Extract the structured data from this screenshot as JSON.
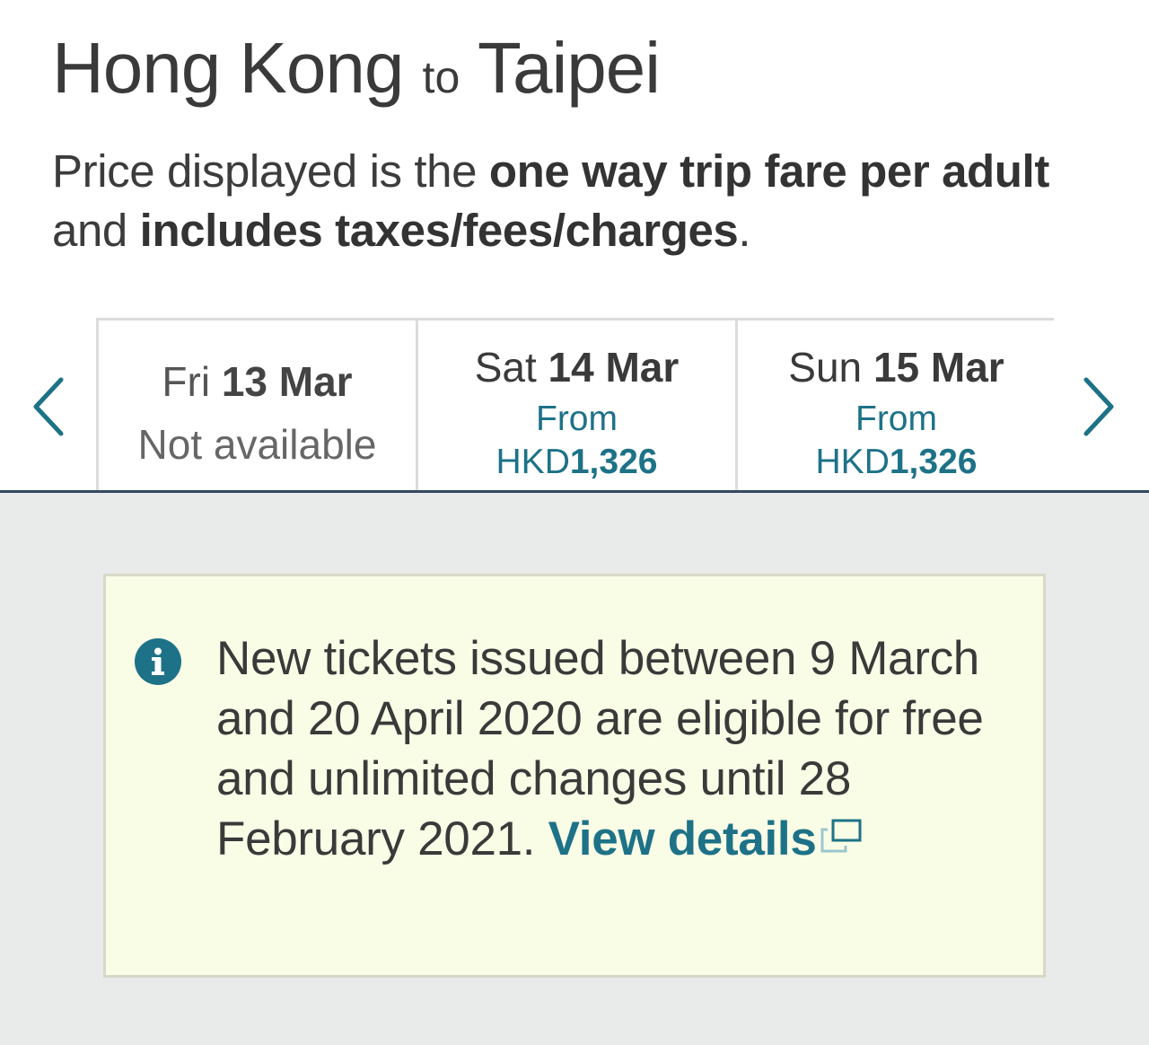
{
  "route": {
    "origin": "Hong Kong",
    "connector": "to",
    "destination": "Taipei"
  },
  "fare_note": {
    "part1": "Price displayed is the ",
    "bold1": "one way trip fare per adult",
    "part2": " and ",
    "bold2": "includes taxes/fees/charges",
    "part3": "."
  },
  "date_carousel": {
    "prev_icon": "chevron-left-icon",
    "next_icon": "chevron-right-icon",
    "dates": [
      {
        "weekday": "Fri",
        "date": "13 Mar",
        "status": "Not available"
      },
      {
        "weekday": "Sat",
        "date": "14 Mar",
        "from_label": "From",
        "currency": "HKD",
        "price": "1,326"
      },
      {
        "weekday": "Sun",
        "date": "15 Mar",
        "from_label": "From",
        "currency": "HKD",
        "price": "1,326"
      }
    ]
  },
  "notice": {
    "icon": "info-icon",
    "text": "New tickets issued between 9 March and 20 April 2020 are eligible for free and unlimited changes until 28 February 2021.",
    "link_label": "View details",
    "link_icon": "external-link-icon"
  },
  "colors": {
    "accent": "#1d7287",
    "divider": "#34495e",
    "notice_bg": "#fafde6",
    "page_lower_bg": "#e9eaea"
  }
}
